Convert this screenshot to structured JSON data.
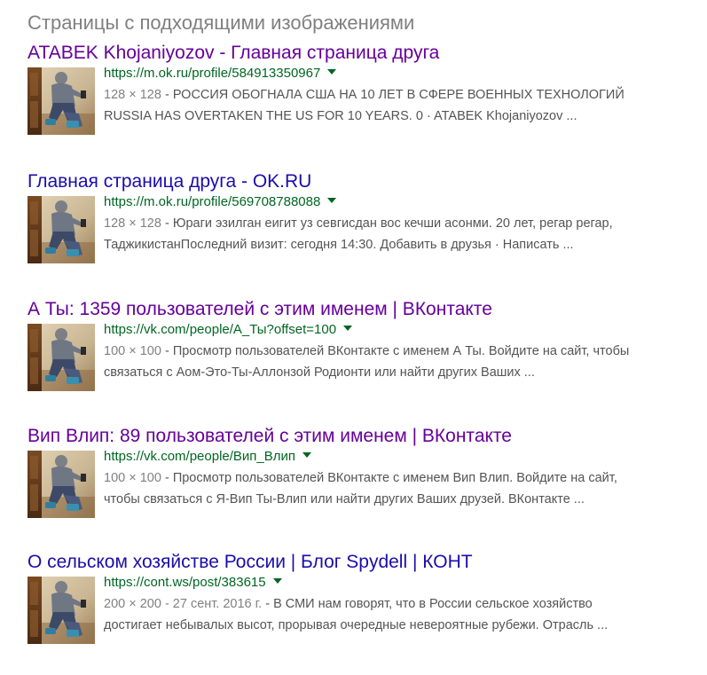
{
  "section": {
    "title": "Страницы с подходящими изображениями"
  },
  "results": [
    {
      "title": "ATABEK Khojaniyozov - Главная страница друга",
      "visited": true,
      "url": "https://m.ok.ru/profile/584913350967",
      "meta": "128 × 128",
      "line1": "РОССИЯ ОБОГНАЛА США НА 10 ЛЕТ В СФЕРЕ ВОЕННЫХ ТЕХНОЛОГИЙ",
      "line2": "RUSSIA HAS OVERTAKEN THE US FOR 10 YEARS. 0 · ATABEK Khojaniyozov ..."
    },
    {
      "title": "Главная страница друга - OK.RU",
      "visited": false,
      "url": "https://m.ok.ru/profile/569708788088",
      "meta": "128 × 128",
      "line1": "Юраги эзилган еигит уз севгисдан вос кечши асонми. 20 лет, регар регар,",
      "line2": "ТаджикистанПоследний визит: сегодня 14:30. Добавить в друзья · Написать ..."
    },
    {
      "title": "А Ты: 1359 пользователей с этим именем | ВКонтакте",
      "visited": true,
      "url": "https://vk.com/people/А_Ты?offset=100",
      "meta": "100 × 100",
      "line1": "Просмотр пользователей ВКонтакте с именем А Ты. Войдите на сайт, чтобы",
      "line2": "связаться с Аом-Это-Ты-Аллонзой Родионти или найти других Ваших ..."
    },
    {
      "title": "Вип Влип: 89 пользователей с этим именем | ВКонтакте",
      "visited": true,
      "url": "https://vk.com/people/Вип_Влип",
      "meta": "100 × 100",
      "line1": "Просмотр пользователей ВКонтакте с именем Вип Влип. Войдите на сайт,",
      "line2": "чтобы связаться с Я-Вип Ты-Влип или найти других Ваших друзей. ВКонтакте ..."
    },
    {
      "title": "О сельском хозяйстве России | Блог Spydell | КОНТ",
      "visited": false,
      "url": "https://cont.ws/post/383615",
      "meta": "200 × 200 - 27 сент. 2016 г.",
      "line1": "В СМИ нам говорят, что в России сельское хозяйство",
      "line2": "достигает небывалых высот, прорывая очередные невероятные рубежи. Отрасль ..."
    }
  ],
  "colors": {
    "visited_link": "#660099",
    "unvisited_link": "#1a0dab",
    "url": "#006621",
    "snippet": "#545454",
    "meta": "#808080"
  },
  "icons": {
    "dropdown": "caret-down-icon",
    "thumbnail": "person-photo-thumbnail"
  }
}
